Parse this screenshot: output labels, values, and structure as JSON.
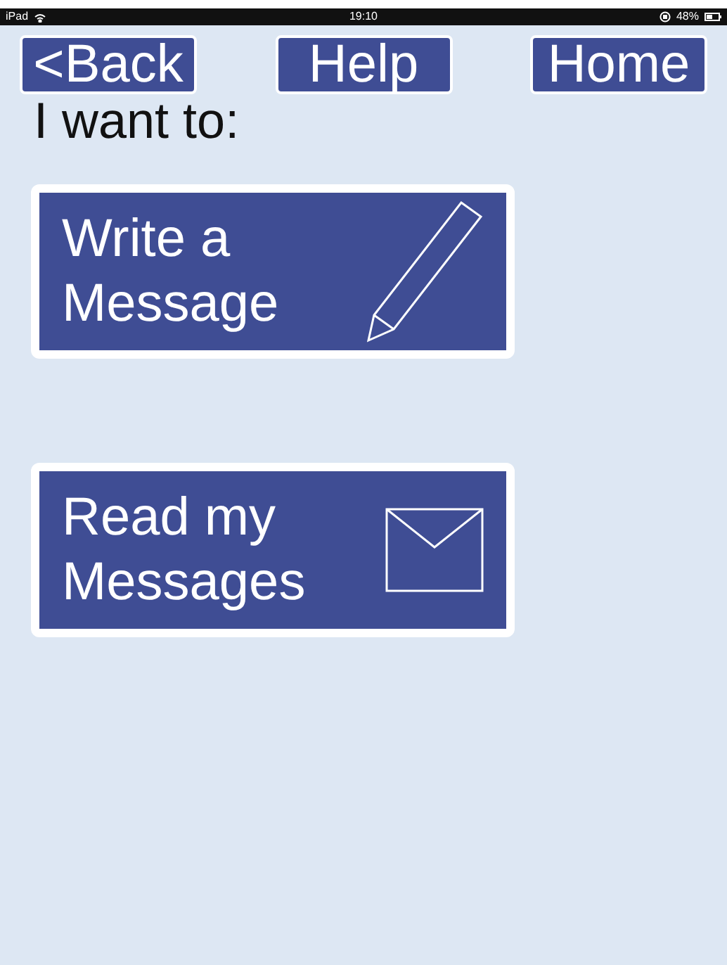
{
  "status_bar": {
    "device": "iPad",
    "time": "19:10",
    "battery": "48%"
  },
  "nav_buttons": [
    {
      "label": "<Back"
    },
    {
      "label": "Help"
    },
    {
      "label": "Home"
    }
  ],
  "prompt": "I want to:",
  "actions": [
    {
      "label_line_1": "Write a",
      "label_line_2": "Message",
      "kind": "pencil"
    },
    {
      "label_line_1": "Read my",
      "label_line_2": "Messages",
      "kind": "envelope"
    }
  ]
}
